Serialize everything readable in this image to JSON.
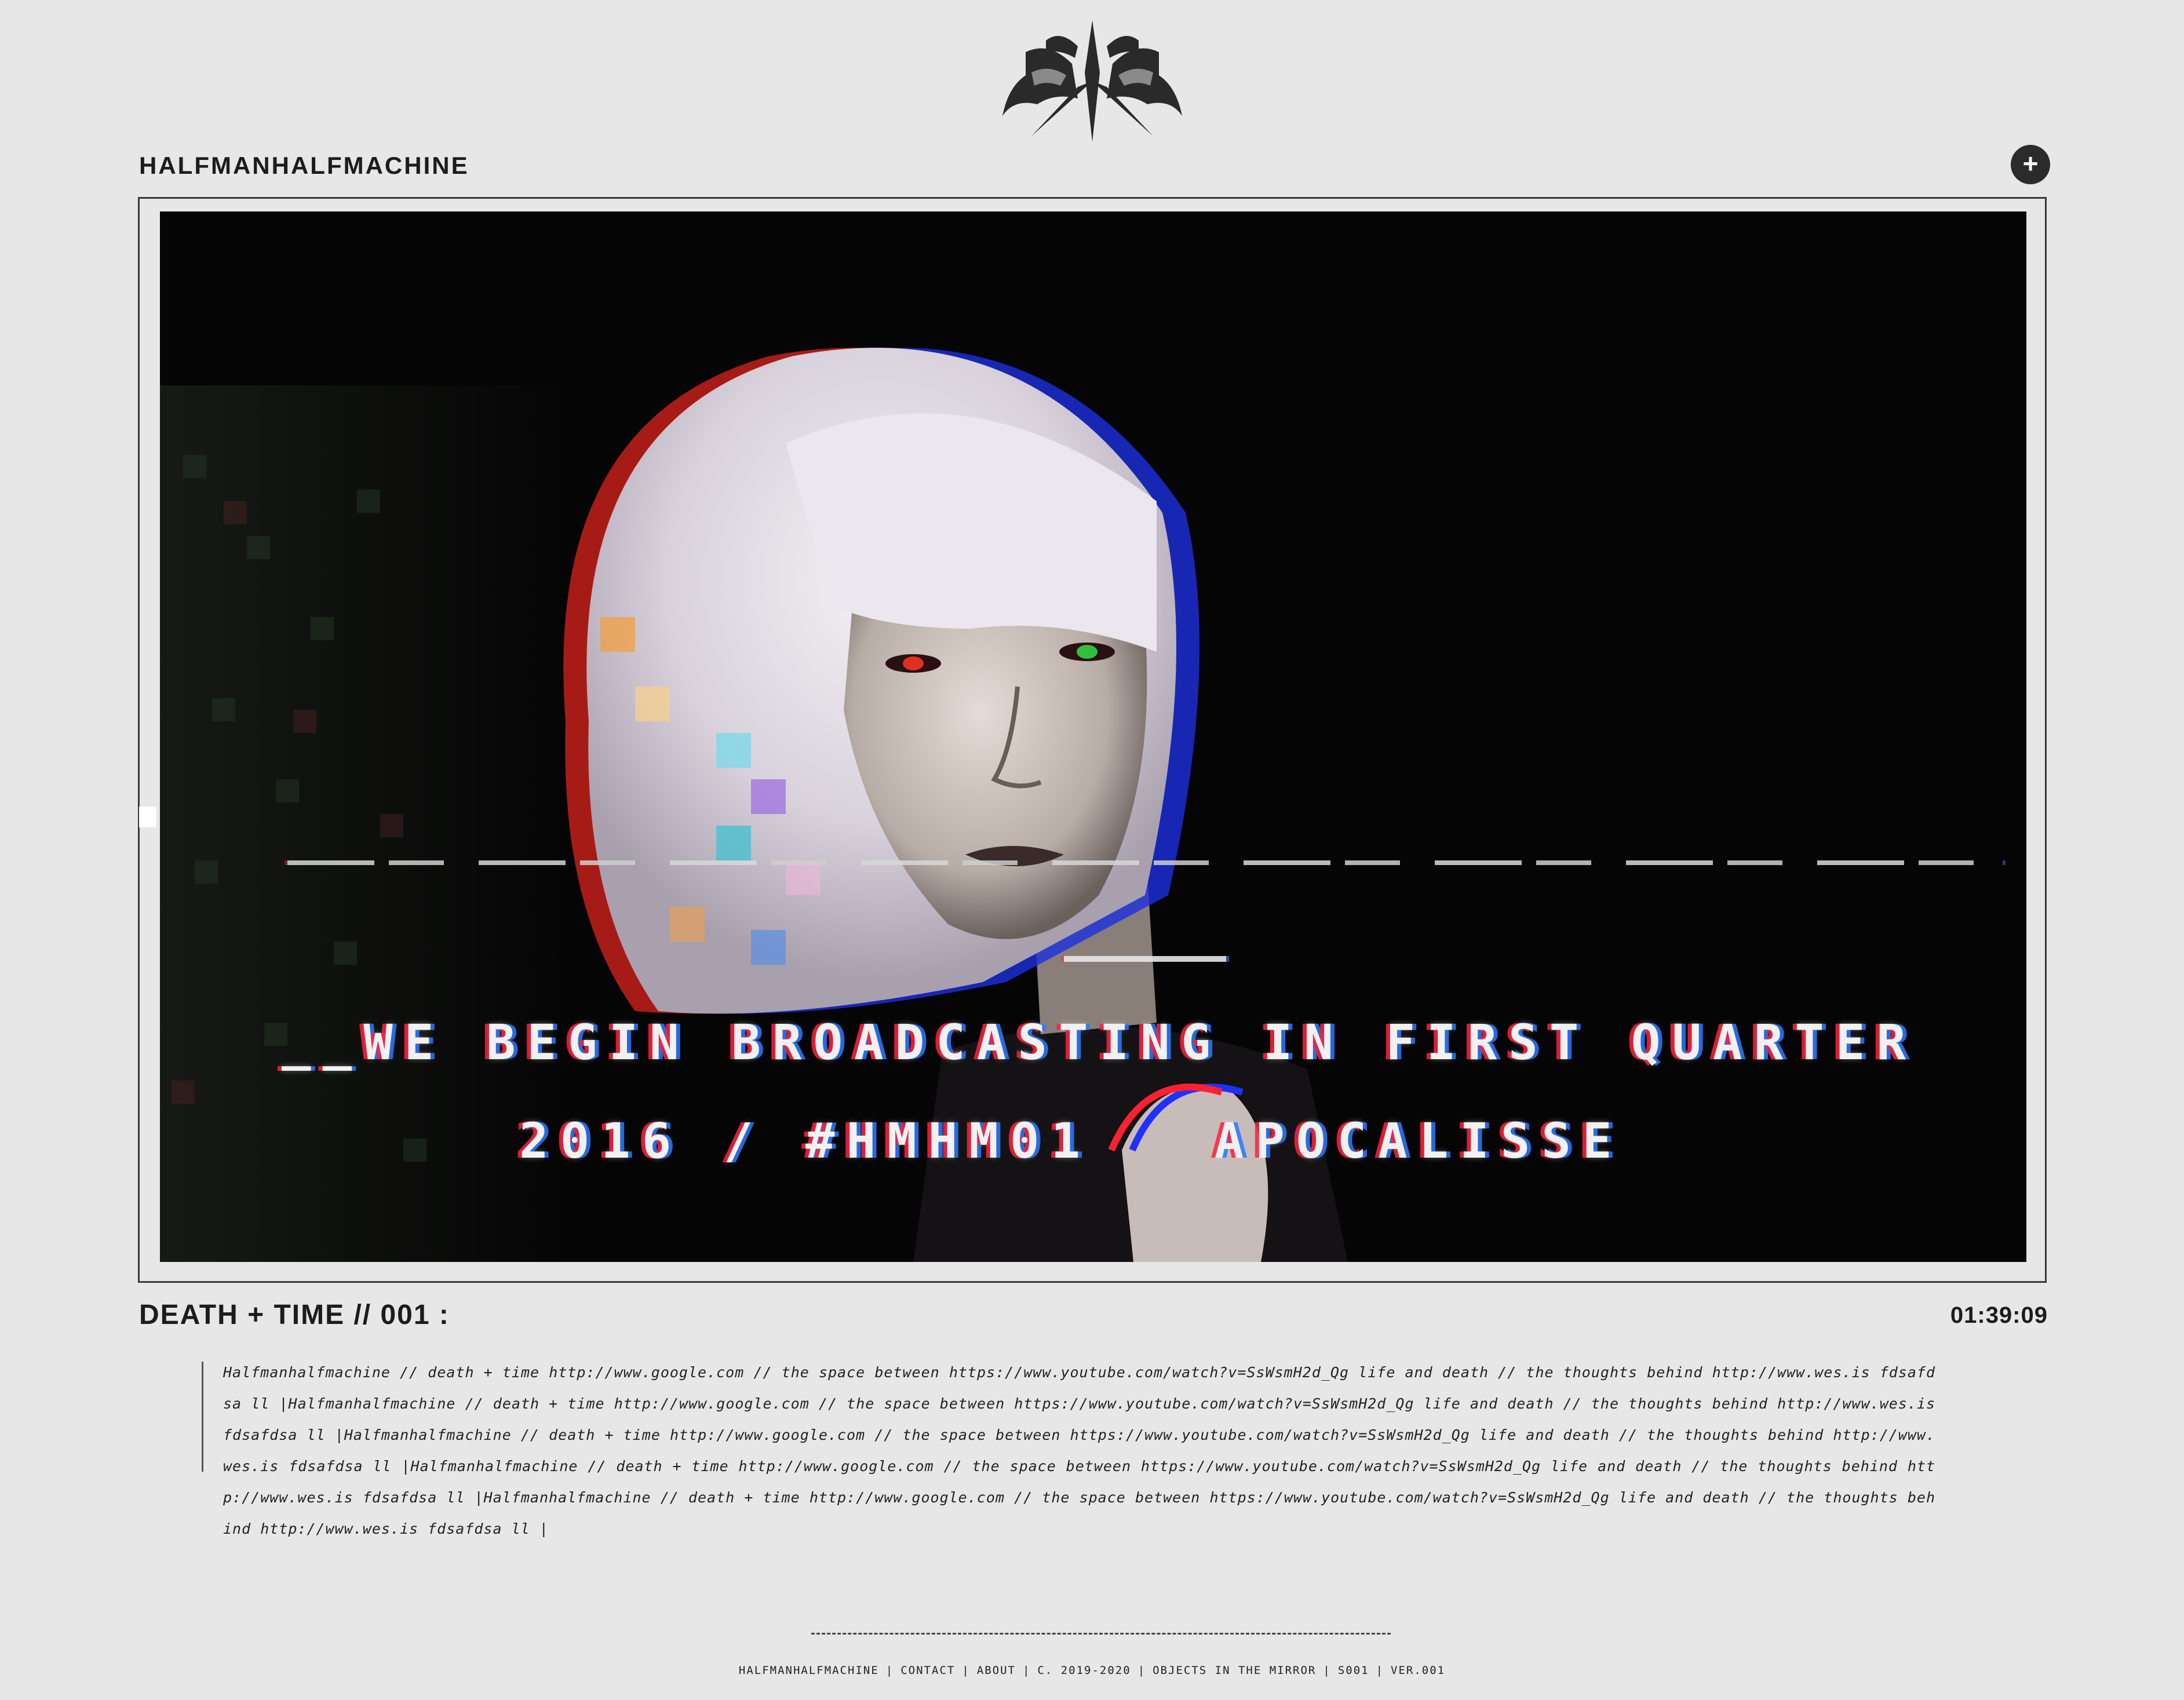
{
  "header": {
    "site_name": "HALFMANHALFMACHINE",
    "menu_button": "+"
  },
  "video": {
    "overlay_line_1": "__WE BEGIN BROADCASTING IN FIRST QUARTER",
    "overlay_line_2": "2016 / #HMHM01   APOCALISSE"
  },
  "episode": {
    "title": "DEATH + TIME // 001 :",
    "timecode": "01:39:09"
  },
  "description": "Halfmanhalfmachine // death + time http://www.google.com // the space between  https://www.youtube.com/watch?v=SsWsmH2d_Qg life and death // the thoughts behind http://www.wes.is fdsafdsa ll |Halfmanhalfmachine // death + time http://www.google.com // the space between  https://www.youtube.com/watch?v=SsWsmH2d_Qg life and death // the thoughts behind http://www.wes.is fdsafdsa ll |Halfmanhalfmachine // death + time http://www.google.com // the space between  https://www.youtube.com/watch?v=SsWsmH2d_Qg life and death // the thoughts behind http://www.wes.is fdsafdsa ll |Halfmanhalfmachine // death + time http://www.google.com // the space between  https://www.youtube.com/watch?v=SsWsmH2d_Qg life and death // the thoughts behind http://www.wes.is fdsafdsa ll |Halfmanhalfmachine // death + time http://www.google.com // the space between  https://www.youtube.com/watch?v=SsWsmH2d_Qg life and death // the thoughts behind http://www.wes.is fdsafdsa ll |",
  "footer": {
    "rule": "------------------------------------------------------------------------",
    "links": [
      "HALFMANHALFMACHINE",
      "CONTACT",
      "ABOUT",
      "C. 2019-2020",
      "OBJECTS IN THE MIRROR",
      "S001",
      "VER.001"
    ],
    "separator": "|"
  },
  "colors": {
    "background": "#e7e7e7",
    "text": "#1c1c1c",
    "video_bg": "#050505",
    "button_bg": "#2b2b2b"
  },
  "icons": {
    "logo": "winged-horses-crest-logo",
    "menu": "plus-icon"
  }
}
